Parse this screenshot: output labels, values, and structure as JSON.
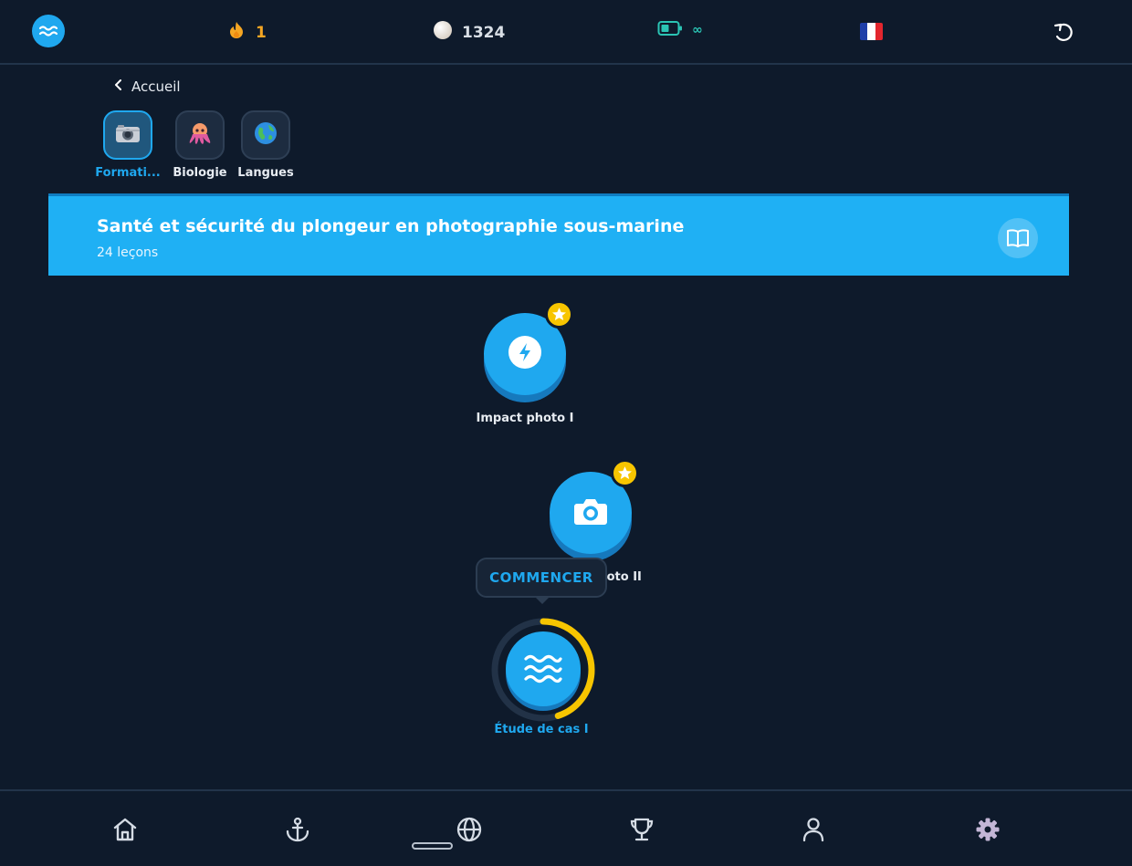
{
  "topbar": {
    "logo_icon": "waves-icon",
    "streak": {
      "icon": "flame-icon",
      "value": "1",
      "color": "#f5a623"
    },
    "pearls": {
      "icon": "pearl-icon",
      "value": "1324"
    },
    "energy": {
      "icon": "battery-icon",
      "value": "∞",
      "color": "#2bc4b4"
    },
    "language_flag": {
      "icon": "french-flag-icon",
      "colors": [
        "#1f3fa8",
        "#ffffff",
        "#e3262e"
      ]
    },
    "refresh_icon": "refresh-icon"
  },
  "breadcrumb": {
    "back_label": "Accueil"
  },
  "categories": [
    {
      "label": "Formati...",
      "icon": "camera-icon",
      "active": true
    },
    {
      "label": "Biologie",
      "icon": "octopus-icon",
      "active": false
    },
    {
      "label": "Langues",
      "icon": "globe-icon",
      "active": false
    }
  ],
  "course": {
    "title": "Santé et sécurité du plongeur en photographie sous-marine",
    "lessons_count": "24 leçons",
    "book_icon": "book-icon",
    "accent": "#1fb0f4"
  },
  "lessons": [
    {
      "label": "Impact photo I",
      "icon": "bolt-icon",
      "status": "completed"
    },
    {
      "label": "Impact photo II",
      "icon": "camera-icon",
      "status": "completed"
    },
    {
      "label": "Étude de cas I",
      "icon": "waves-icon",
      "status": "current",
      "progress_fraction": 0.45
    }
  ],
  "tooltip": {
    "label": "COMMENCER"
  },
  "bottom_nav": [
    {
      "name": "home",
      "icon": "home-icon"
    },
    {
      "name": "anchor",
      "icon": "anchor-icon"
    },
    {
      "name": "world",
      "icon": "globe-icon"
    },
    {
      "name": "trophy",
      "icon": "trophy-icon"
    },
    {
      "name": "profile",
      "icon": "user-icon"
    },
    {
      "name": "settings",
      "icon": "gear-icon"
    }
  ]
}
